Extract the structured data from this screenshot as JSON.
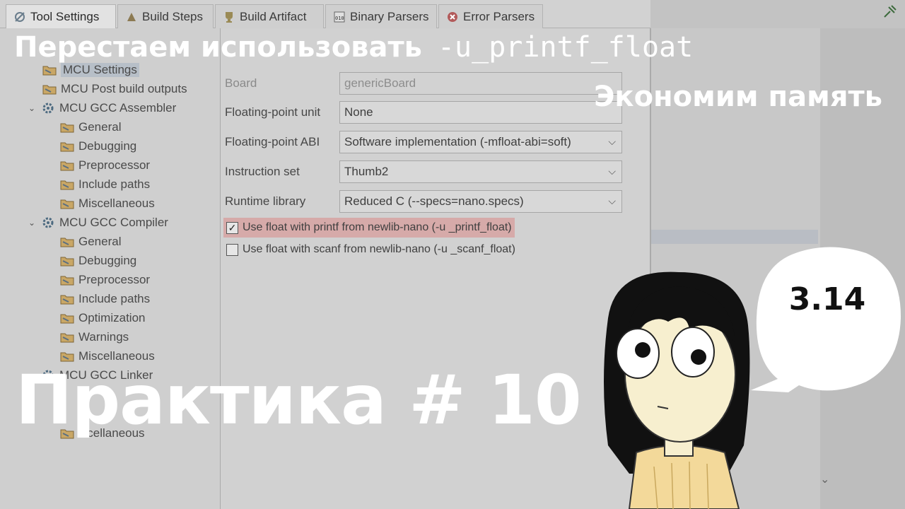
{
  "tabs": [
    {
      "label": "Tool Settings",
      "icon": "tool-settings-icon",
      "active": true
    },
    {
      "label": "Build Steps",
      "icon": "build-steps-icon"
    },
    {
      "label": "Build Artifact",
      "icon": "build-artifact-icon"
    },
    {
      "label": "Binary Parsers",
      "icon": "binary-parsers-icon"
    },
    {
      "label": "Error Parsers",
      "icon": "error-parsers-icon"
    }
  ],
  "tree": {
    "items": [
      {
        "label": "MCU Settings",
        "kind": "folder",
        "level": 1,
        "selected": true
      },
      {
        "label": "MCU Post build outputs",
        "kind": "folder",
        "level": 1
      },
      {
        "label": "MCU GCC Assembler",
        "kind": "tool",
        "level": 0
      },
      {
        "label": "General",
        "kind": "folder",
        "level": 2
      },
      {
        "label": "Debugging",
        "kind": "folder",
        "level": 2
      },
      {
        "label": "Preprocessor",
        "kind": "folder",
        "level": 2
      },
      {
        "label": "Include paths",
        "kind": "folder",
        "level": 2
      },
      {
        "label": "Miscellaneous",
        "kind": "folder",
        "level": 2
      },
      {
        "label": "MCU GCC Compiler",
        "kind": "tool",
        "level": 0
      },
      {
        "label": "General",
        "kind": "folder",
        "level": 2
      },
      {
        "label": "Debugging",
        "kind": "folder",
        "level": 2
      },
      {
        "label": "Preprocessor",
        "kind": "folder",
        "level": 2
      },
      {
        "label": "Include paths",
        "kind": "folder",
        "level": 2
      },
      {
        "label": "Optimization",
        "kind": "folder",
        "level": 2
      },
      {
        "label": "Warnings",
        "kind": "folder",
        "level": 2
      },
      {
        "label": "Miscellaneous",
        "kind": "folder",
        "level": 2
      },
      {
        "label": "MCU GCC Linker",
        "kind": "tool",
        "level": 0
      },
      {
        "label": "iscellaneous",
        "kind": "folder",
        "level": 2
      }
    ]
  },
  "settings": {
    "board": {
      "label": "Board",
      "value": "genericBoard"
    },
    "fpu": {
      "label": "Floating-point unit",
      "value": "None"
    },
    "abi": {
      "label": "Floating-point ABI",
      "value": "Software implementation (-mfloat-abi=soft)"
    },
    "iset": {
      "label": "Instruction set",
      "value": "Thumb2"
    },
    "runtime": {
      "label": "Runtime library",
      "value": "Reduced C (--specs=nano.specs)"
    },
    "printf_float": {
      "label": "Use float with printf from newlib-nano (-u _printf_float)",
      "checked": true
    },
    "scanf_float": {
      "label": "Use float with scanf from newlib-nano (-u _scanf_float)",
      "checked": false
    }
  },
  "overlay": {
    "title_ru": "Перестаем использовать",
    "title_flag": "-u_printf_float",
    "subtitle": "Экономим память",
    "big_title": "Практика # 10",
    "bubble": "3.14"
  },
  "colors": {
    "highlight_row": "#d6aaa9",
    "overlay_text": "#ffffff",
    "skin": "#f7efcf",
    "shirt": "#f3d99a",
    "hair": "#111111"
  }
}
